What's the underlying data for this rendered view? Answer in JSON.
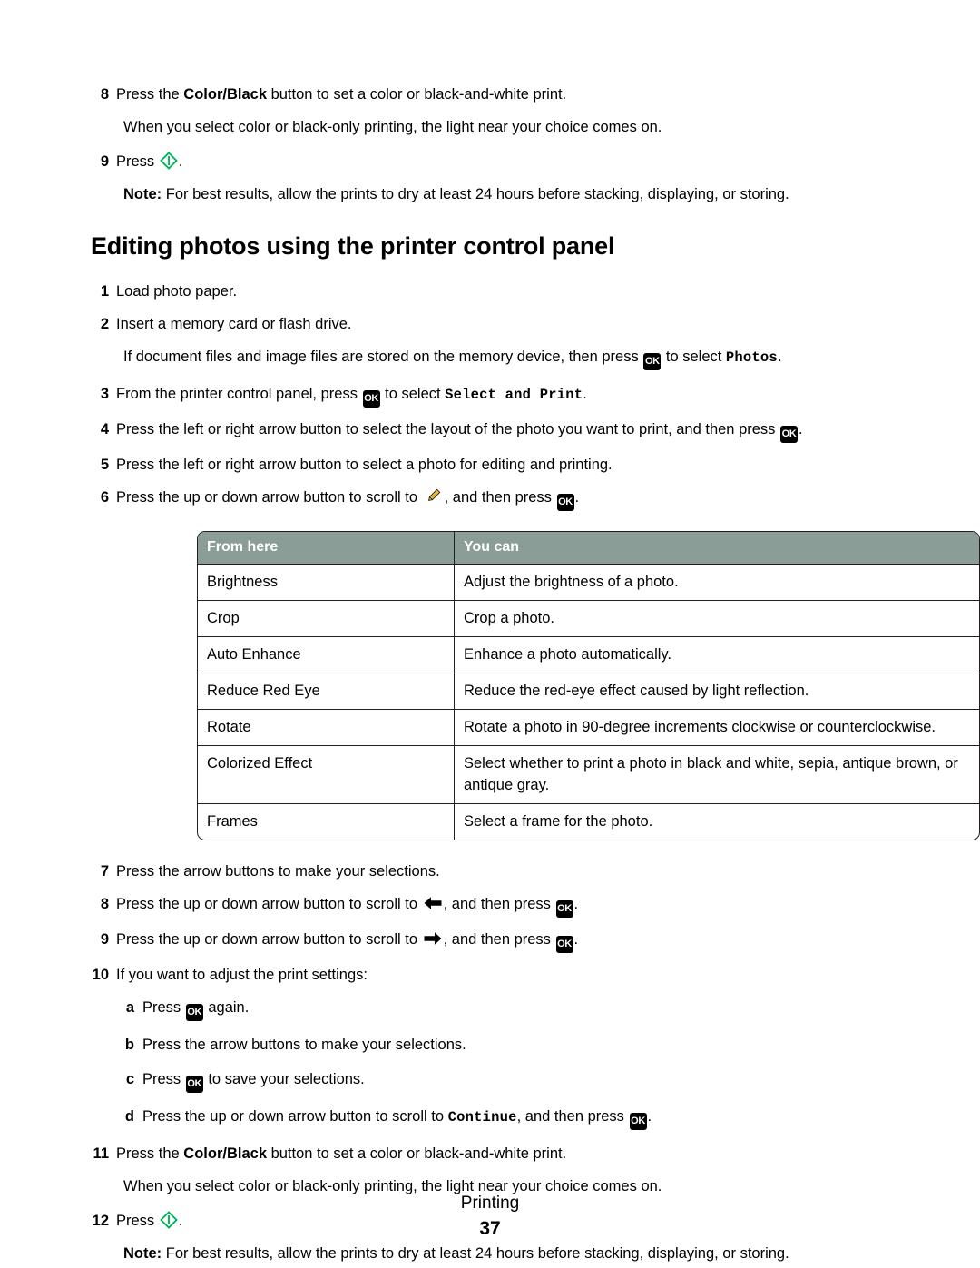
{
  "document": {
    "top_steps": [
      {
        "number": "8",
        "text_before": "Press the ",
        "bold": "Color/Black",
        "text_after": " button to set a color or black-and-white print.",
        "continuation": "When you select color or black-only printing, the light near your choice comes on."
      },
      {
        "number": "9",
        "text_before": "Press ",
        "icon": "start-button-icon",
        "text_after": ".",
        "note_label": "Note:",
        "note_text": " For best results, allow the prints to dry at least 24 hours before stacking, displaying, or storing."
      }
    ],
    "section_title": "Editing photos using the printer control panel",
    "steps": [
      {
        "number": "1",
        "text": "Load photo paper."
      },
      {
        "number": "2",
        "text": "Insert a memory card or flash drive."
      }
    ],
    "step2_continuation": {
      "before": "If document files and image files are stored on the memory device, then press ",
      "icon": "ok-button-icon",
      "middle": " to select ",
      "mono": "Photos",
      "after": "."
    },
    "step3": {
      "number": "3",
      "before": "From the printer control panel, press ",
      "icon": "ok-button-icon",
      "middle": " to select ",
      "mono": "Select and Print",
      "after": "."
    },
    "step4": {
      "number": "4",
      "before": "Press the left or right arrow button to select the layout of the photo you want to print, and then press ",
      "icon": "ok-button-icon",
      "after": "."
    },
    "step5": {
      "number": "5",
      "text": "Press the left or right arrow button to select a photo for editing and printing."
    },
    "step6": {
      "number": "6",
      "before": "Press the up or down arrow button to scroll to ",
      "icon1": "pencil-edit-icon",
      "middle": ", and then press ",
      "icon2": "ok-button-icon",
      "after": "."
    },
    "table": {
      "headers": [
        "From here",
        "You can"
      ],
      "rows": [
        [
          "Brightness",
          "Adjust the brightness of a photo."
        ],
        [
          "Crop",
          "Crop a photo."
        ],
        [
          "Auto Enhance",
          "Enhance a photo automatically."
        ],
        [
          "Reduce Red Eye",
          "Reduce the red-eye effect caused by light reflection."
        ],
        [
          "Rotate",
          "Rotate a photo in 90-degree increments clockwise or counterclockwise."
        ],
        [
          "Colorized Effect",
          "Select whether to print a photo in black and white, sepia, antique brown, or antique gray."
        ],
        [
          "Frames",
          "Select a frame for the photo."
        ]
      ]
    },
    "step7": {
      "number": "7",
      "text": "Press the arrow buttons to make your selections."
    },
    "step8b": {
      "number": "8",
      "before": "Press the up or down arrow button to scroll to ",
      "icon1": "left-arrow-icon",
      "middle": ", and then press ",
      "icon2": "ok-button-icon",
      "after": "."
    },
    "step9b": {
      "number": "9",
      "before": "Press the up or down arrow button to scroll to ",
      "icon1": "right-arrow-icon",
      "middle": ", and then press ",
      "icon2": "ok-button-icon",
      "after": "."
    },
    "step10": {
      "number": "10",
      "text": "If you want to adjust the print settings:",
      "substeps": [
        {
          "letter": "a",
          "before": "Press ",
          "icon": "ok-button-icon",
          "after": " again."
        },
        {
          "letter": "b",
          "before": "Press the arrow buttons to make your selections.",
          "icon": null,
          "after": ""
        },
        {
          "letter": "c",
          "before": "Press ",
          "icon": "ok-button-icon",
          "after": " to save your selections."
        },
        {
          "letter": "d",
          "before": "Press the up or down arrow button to scroll to ",
          "mono": "Continue",
          "middle": ", and then press ",
          "icon": "ok-button-icon",
          "after": "."
        }
      ]
    },
    "step11": {
      "number": "11",
      "text_before": "Press the ",
      "bold": "Color/Black",
      "text_after": " button to set a color or black-and-white print.",
      "continuation": "When you select color or black-only printing, the light near your choice comes on."
    },
    "step12": {
      "number": "12",
      "text_before": "Press ",
      "icon": "start-button-icon",
      "text_after": ".",
      "note_label": "Note:",
      "note_text": " For best results, allow the prints to dry at least 24 hours before stacking, displaying, or storing."
    },
    "footer": {
      "label": "Printing",
      "page": "37"
    },
    "colors": {
      "table_header_bg": "#8b9d97",
      "table_border": "#231f20",
      "start_icon_green": "#00b25a",
      "pencil_yellow": "#f5c23e",
      "ok_icon_bg": "#000000"
    }
  }
}
